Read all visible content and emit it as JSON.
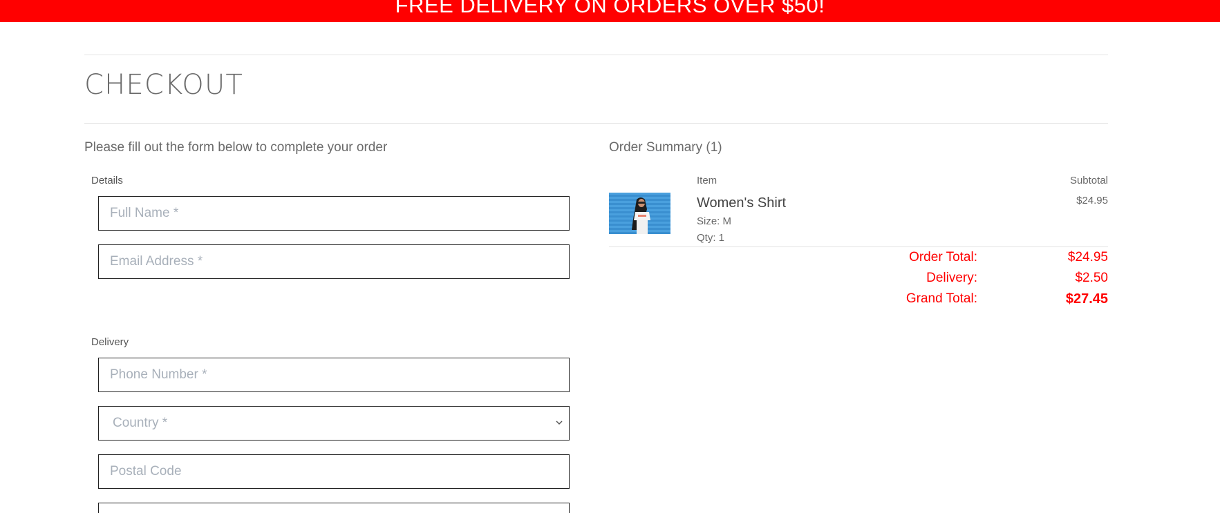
{
  "banner": {
    "text": "FREE DELIVERY ON ORDERS OVER $50!"
  },
  "page": {
    "title": "CHECKOUT"
  },
  "form": {
    "intro": "Please fill out the form below to complete your order",
    "details_label": "Details",
    "full_name_placeholder": "Full Name *",
    "email_placeholder": "Email Address *",
    "delivery_label": "Delivery",
    "phone_placeholder": "Phone Number *",
    "country_selected": "Country *",
    "postal_placeholder": "Postal Code"
  },
  "summary": {
    "title": "Order Summary (1)",
    "col_item": "Item",
    "col_subtotal": "Subtotal",
    "items": [
      {
        "name": "Women's Shirt",
        "size": "Size: M",
        "qty": "Qty: 1",
        "price": "$24.95"
      }
    ],
    "order_total_label": "Order Total:",
    "order_total_value": "$24.95",
    "delivery_label": "Delivery:",
    "delivery_value": "$2.50",
    "grand_total_label": "Grand Total:",
    "grand_total_value": "$27.45"
  },
  "colors": {
    "accent": "#ff0000",
    "border": "#222222",
    "placeholder": "#a8b0ba",
    "thumb_background": "#4aa0de"
  },
  "icons": {
    "country_dropdown": "chevron-down-icon"
  }
}
